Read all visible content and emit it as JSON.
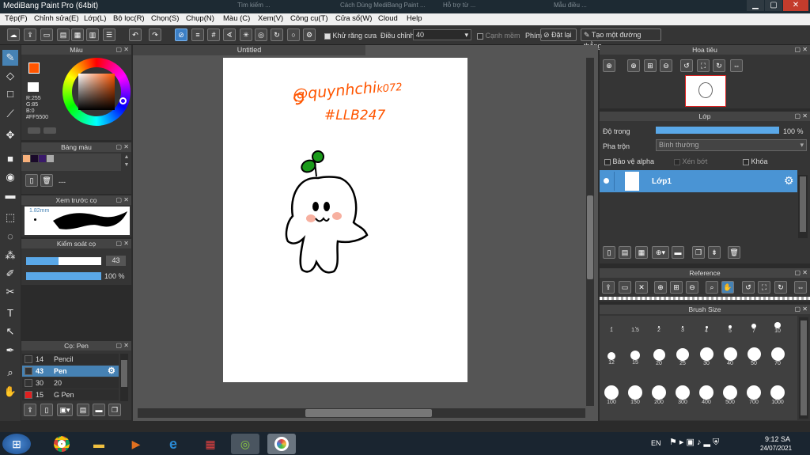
{
  "title_bar": {
    "title": "MediBang Paint Pro (64bit)",
    "ghost_tabs": [
      "...",
      "Tìm kiếm ...",
      "Cách Dùng MediBang Paint ...",
      "Hỗ trợ từ ...",
      "Mẫu điều ...",
      "..."
    ],
    "minimize": "▁",
    "maximize": "▢",
    "close": "✕"
  },
  "menu": [
    "Tệp(F)",
    "Chỉnh sửa(E)",
    "Lớp(L)",
    "Bộ lọc(R)",
    "Chọn(S)",
    "Chụp(N)",
    "Màu (C)",
    "Xem(V)",
    "Công cụ(T)",
    "Cửa sổ(W)",
    "Cloud",
    "Help"
  ],
  "toolbar": {
    "antialias_label": "Khử răng cưa",
    "correction_label": "Điều chỉnh",
    "correction_value": "40",
    "edge_label": "Cạnh mềm",
    "phim_label": "Phím",
    "reset_label": "Đặt lại",
    "line_label": "Tạo một đường thẳng"
  },
  "color_panel": {
    "title": "Màu",
    "r": "R:255",
    "g": "G:85",
    "b": "B:0",
    "hex": "#FF5500",
    "main_color": "#ff5500"
  },
  "palette_panel": {
    "title": "Bảng màu",
    "dash": "---",
    "swatches": [
      "#f7b07b",
      "#1a0a2a",
      "#3a1a6a",
      "#aaaaaa"
    ]
  },
  "preview_panel": {
    "title": "Xem trước cọ",
    "size": "1.82mm"
  },
  "control_panel": {
    "title": "Kiểm soát cọ",
    "size_value": "43",
    "size_fill": 43,
    "opacity_value": "100 %",
    "opacity_fill": 100
  },
  "brush_panel": {
    "title": "Cọ: Pen",
    "brushes": [
      {
        "size": "14",
        "name": "Pencil",
        "color": "#333333"
      },
      {
        "size": "43",
        "name": "Pen",
        "color": "#333333",
        "selected": true
      },
      {
        "size": "30",
        "name": "20",
        "color": "#333333"
      },
      {
        "size": "15",
        "name": "G Pen",
        "color": "#e02020"
      }
    ]
  },
  "canvas": {
    "tab_title": "Untitled",
    "line1": "@quynhchi",
    "line1b": "k072",
    "line2": "#LLB247"
  },
  "navigator": {
    "title": "Hoa tiêu"
  },
  "layer_panel": {
    "title": "Lớp",
    "opacity_label": "Độ trong",
    "opacity_value": "100 %",
    "blend_label": "Pha trộn",
    "blend_value": "Bình thường",
    "alpha_label": "Bảo vệ alpha",
    "clip_label": "Xén bớt",
    "lock_label": "Khóa",
    "layer_name": "Lớp1"
  },
  "reference_panel": {
    "title": "Reference"
  },
  "brush_size_panel": {
    "title": "Brush Size",
    "sizes": [
      "1",
      "1.5",
      "2",
      "3",
      "4",
      "5",
      "7",
      "10",
      "12",
      "15",
      "20",
      "25",
      "30",
      "40",
      "50",
      "70",
      "100",
      "150",
      "200",
      "300",
      "400",
      "500",
      "700",
      "1000"
    ]
  },
  "taskbar": {
    "lang": "EN",
    "time": "9:12 SA",
    "date": "24/07/2021"
  }
}
